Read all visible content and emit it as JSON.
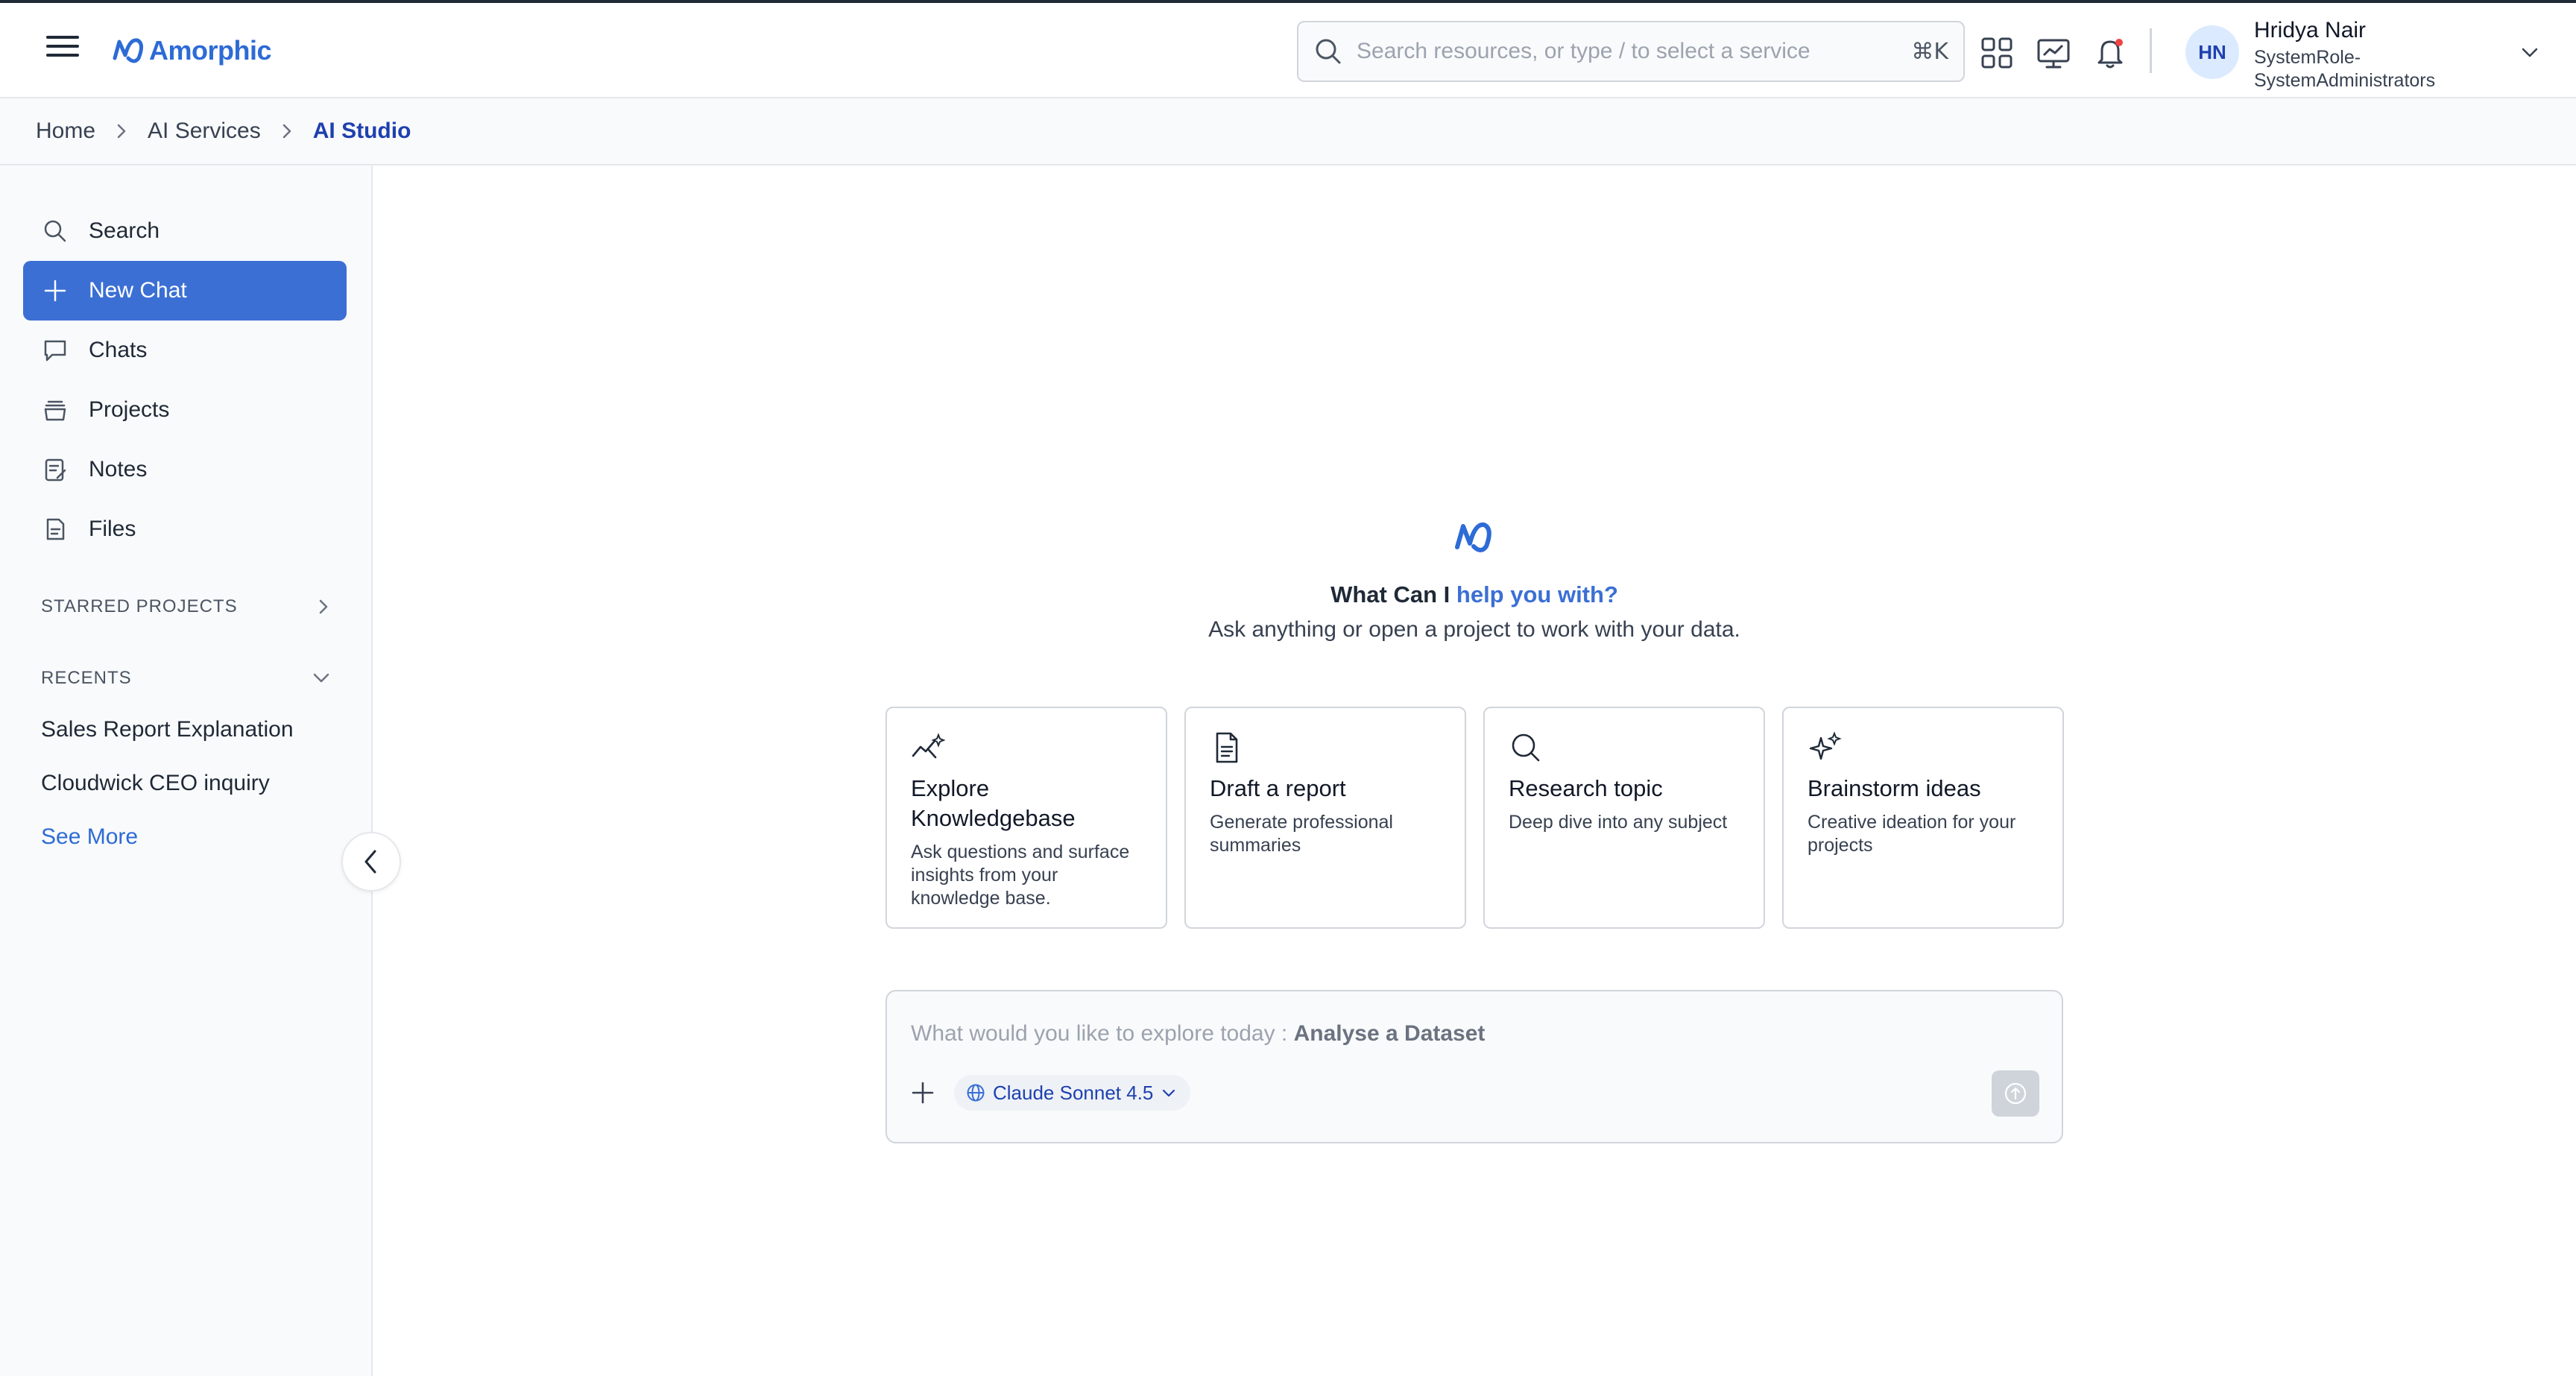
{
  "app": {
    "brand": "Amorphic"
  },
  "header": {
    "search_placeholder": "Search resources, or type / to select a service",
    "search_shortcut": "⌘K",
    "user": {
      "initials": "HN",
      "name": "Hridya Nair",
      "role": "SystemRole-SystemAdministrators"
    }
  },
  "breadcrumb": [
    {
      "label": "Home"
    },
    {
      "label": "AI Services"
    },
    {
      "label": "AI Studio"
    }
  ],
  "sidebar": {
    "items": [
      {
        "label": "Search",
        "icon": "search-icon"
      },
      {
        "label": "New Chat",
        "icon": "plus-icon",
        "active": true
      },
      {
        "label": "Chats",
        "icon": "chat-bubble-icon"
      },
      {
        "label": "Projects",
        "icon": "projects-icon"
      },
      {
        "label": "Notes",
        "icon": "notes-icon"
      },
      {
        "label": "Files",
        "icon": "files-icon"
      }
    ],
    "starred_label": "STARRED PROJECTS",
    "recents_label": "RECENTS",
    "recents": [
      {
        "label": "Sales Report Explanation"
      },
      {
        "label": "Cloudwick CEO inquiry"
      }
    ],
    "see_more": "See More"
  },
  "main": {
    "title_prefix": "What Can I ",
    "title_accent": "help you with?",
    "subtitle": "Ask anything or open a project to work with your data.",
    "cards": [
      {
        "title": "Explore Knowledgebase",
        "description": "Ask questions and surface insights from your knowledge base.",
        "icon": "sparkline-icon"
      },
      {
        "title": "Draft a report",
        "description": "Generate professional summaries",
        "icon": "document-icon"
      },
      {
        "title": "Research topic",
        "description": "Deep dive into any subject",
        "icon": "search-icon"
      },
      {
        "title": "Brainstorm ideas",
        "description": "Creative ideation for your projects",
        "icon": "sparkles-icon"
      }
    ],
    "composer": {
      "placeholder_prefix": "What would you like to explore today : ",
      "placeholder_example": "Analyse a Dataset",
      "model": "Claude Sonnet 4.5"
    }
  },
  "colors": {
    "accent": "#3b6fd4",
    "brand": "#2d6bd6",
    "notification_dot": "#ef4444"
  }
}
